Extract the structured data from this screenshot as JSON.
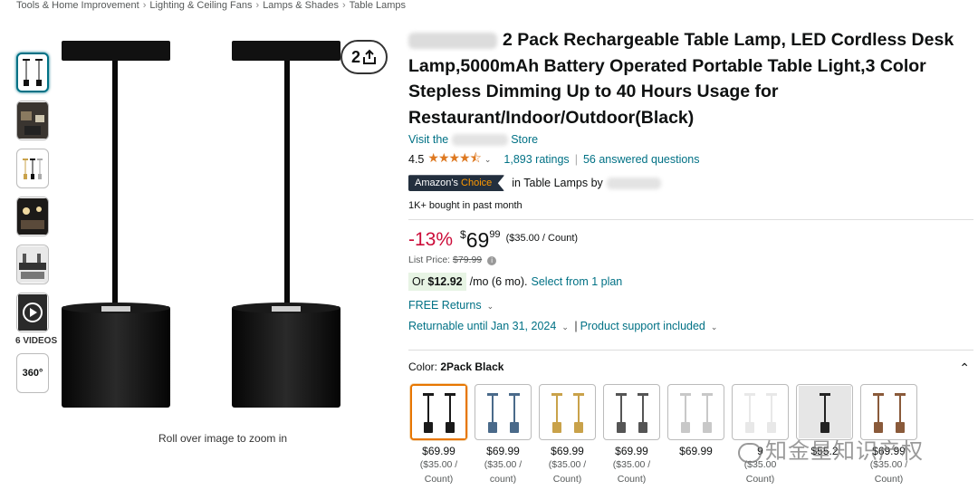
{
  "breadcrumb": [
    "Tools & Home Improvement",
    "Lighting & Ceiling Fans",
    "Lamps & Shades",
    "Table Lamps"
  ],
  "breadcrumb_sep": "›",
  "gallery": {
    "videos_label": "6 VIDEOS",
    "spin_label": "360°",
    "zoom_hint": "Roll over image to zoom in",
    "share_count": "2"
  },
  "product": {
    "title": "2 Pack Rechargeable Table Lamp, LED Cordless Desk Lamp,5000mAh Battery Operated Portable Table Light,3 Color Stepless Dimming Up to 40 Hours Usage for Restaurant/Indoor/Outdoor(Black)",
    "store_prefix": "Visit the",
    "store_suffix": "Store",
    "rating_value": "4.5",
    "stars": "★★★★⯪",
    "ratings_count": "1,893 ratings",
    "answered": "56 answered questions",
    "badge_amazons": "Amazon's",
    "badge_choice": "Choice",
    "choice_text": "in Table Lamps by",
    "bought": "1K+ bought in past month"
  },
  "price": {
    "discount": "-13%",
    "currency": "$",
    "whole": "69",
    "fraction": "99",
    "unit": "($35.00 / Count)",
    "list_label": "List Price:",
    "list_value": "$79.99",
    "plan_or": "Or",
    "plan_amount": "$12.92",
    "plan_term": "/mo (6 mo).",
    "plan_link": "Select from 1 plan",
    "free_returns": "FREE Returns",
    "returnable": "Returnable until Jan 31, 2024",
    "support": "Product support included"
  },
  "color": {
    "label": "Color:",
    "selected": "2Pack Black",
    "swatches": [
      {
        "price": "$69.99",
        "unit": "($35.00 /",
        "unit2": "Count)",
        "shade": "#1a1a1a"
      },
      {
        "price": "$69.99",
        "unit": "($35.00 /",
        "unit2": "count)",
        "shade": "#4a6a8a"
      },
      {
        "price": "$69.99",
        "unit": "($35.00 /",
        "unit2": "Count)",
        "shade": "#c9a24a"
      },
      {
        "price": "$69.99",
        "unit": "($35.00 /",
        "unit2": "Count)",
        "shade": "#555555"
      },
      {
        "price": "$69.99",
        "unit": "",
        "unit2": "",
        "shade": "#c8c8c8"
      },
      {
        "price": "9",
        "unit": "($35.00",
        "unit2": "Count)",
        "shade": "#e8e8e8"
      },
      {
        "price": "$55.2",
        "unit": "",
        "unit2": "",
        "shade": "#222222"
      },
      {
        "price": "$69.99",
        "unit": "($35.00 /",
        "unit2": "Count)",
        "shade": "#8a5a3a"
      }
    ]
  },
  "watermark": "知金星知识产权",
  "colors": {
    "link": "#007185",
    "discount": "#cc0c39",
    "star": "#de7921",
    "badge_bg": "#232f3e",
    "badge_accent": "#ff9900",
    "selected_border": "#e77600"
  }
}
